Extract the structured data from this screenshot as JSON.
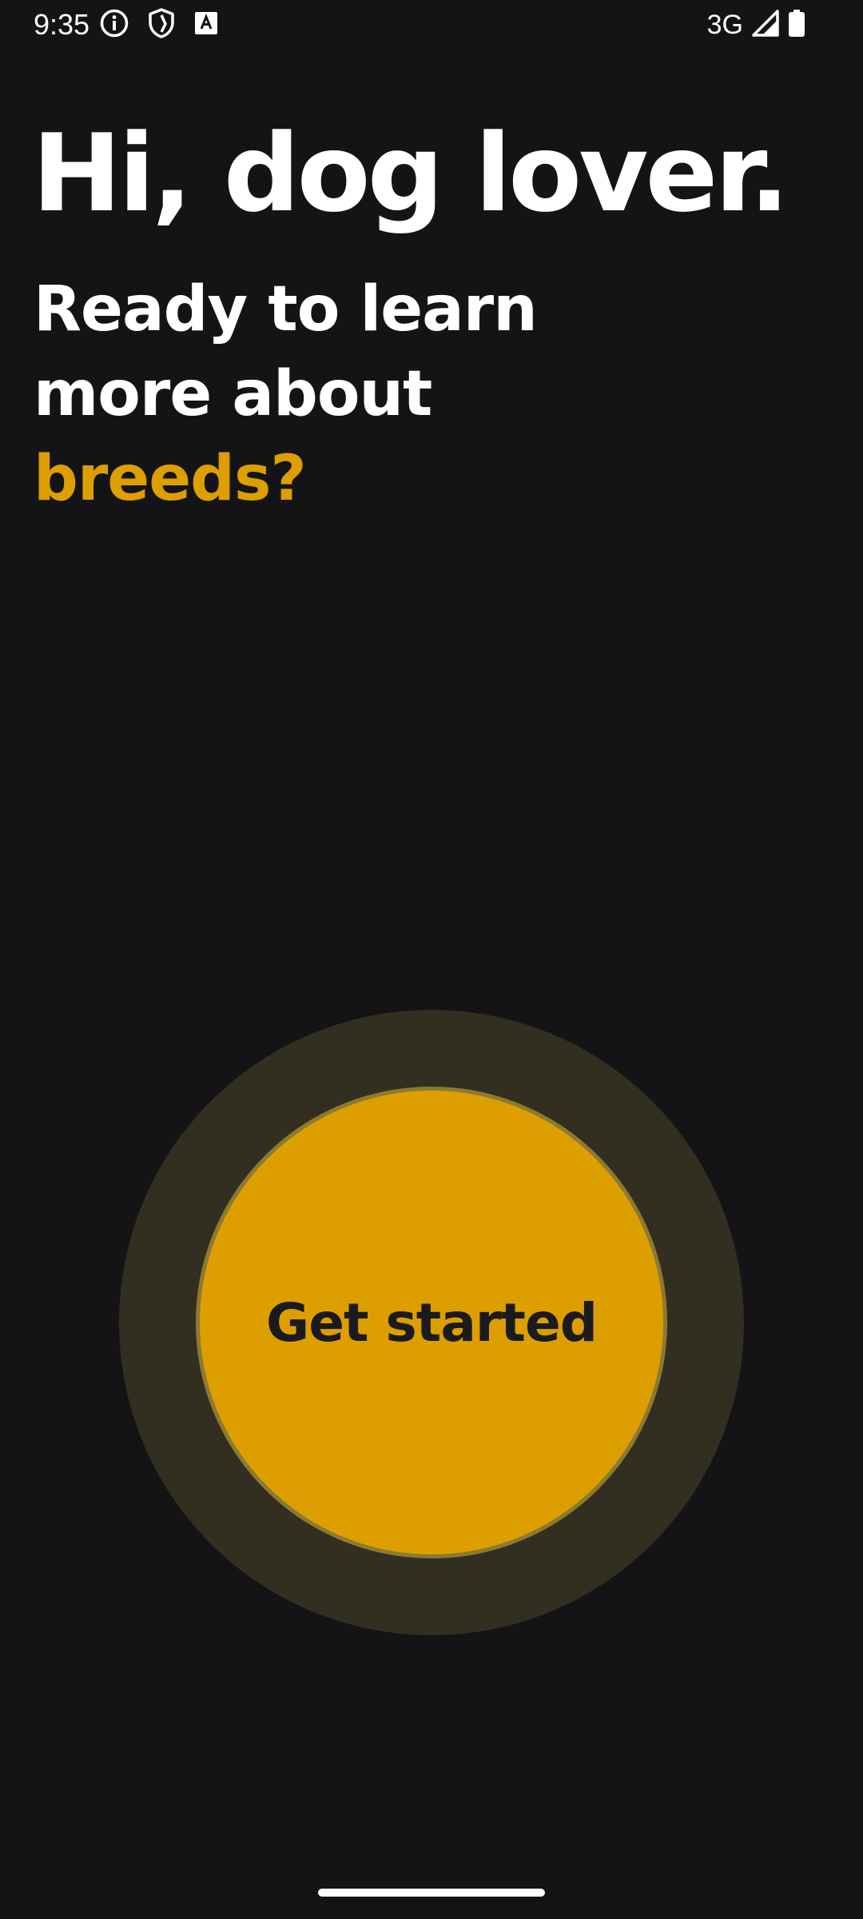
{
  "status_bar": {
    "time": "9:35",
    "icons": [
      "info-icon",
      "shield-icon",
      "font-a-icon"
    ],
    "network": "3G",
    "signal_icon": "signal-icon",
    "battery_icon": "battery-icon"
  },
  "onboarding": {
    "headline": "Hi, dog lover.",
    "subline_line1": "Ready to learn",
    "subline_line2": "more about",
    "subline_highlight": "breeds?",
    "cta_label": "Get started"
  },
  "colors": {
    "background": "#141416",
    "accent": "#dd9f00",
    "ring": "#322f21",
    "text": "#ffffff"
  }
}
